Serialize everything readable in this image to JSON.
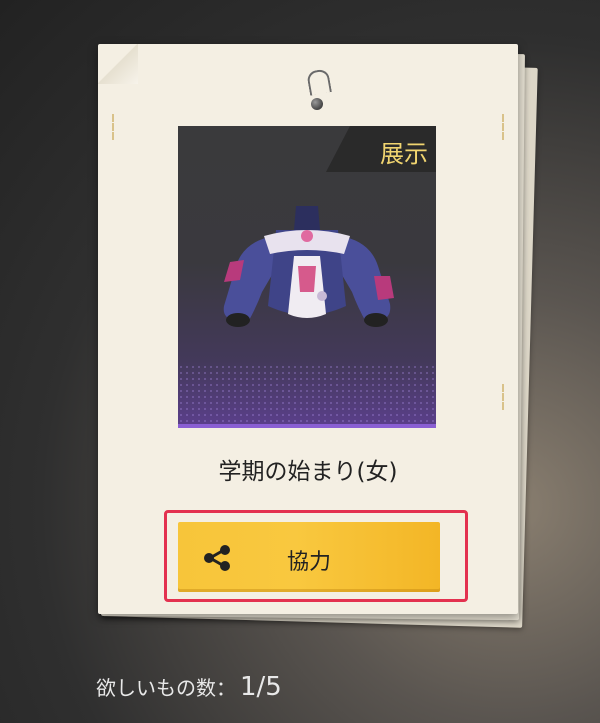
{
  "card": {
    "display_tag": "展示",
    "item_name": "学期の始まり(女)",
    "help_button_label": "協力"
  },
  "wishlist": {
    "label": "欲しいもの数：",
    "count": "1/5"
  },
  "colors": {
    "button": "#f7c53a",
    "highlight": "#e3314f",
    "tag_text": "#f1d570"
  },
  "icons": {
    "share": "share-icon"
  }
}
